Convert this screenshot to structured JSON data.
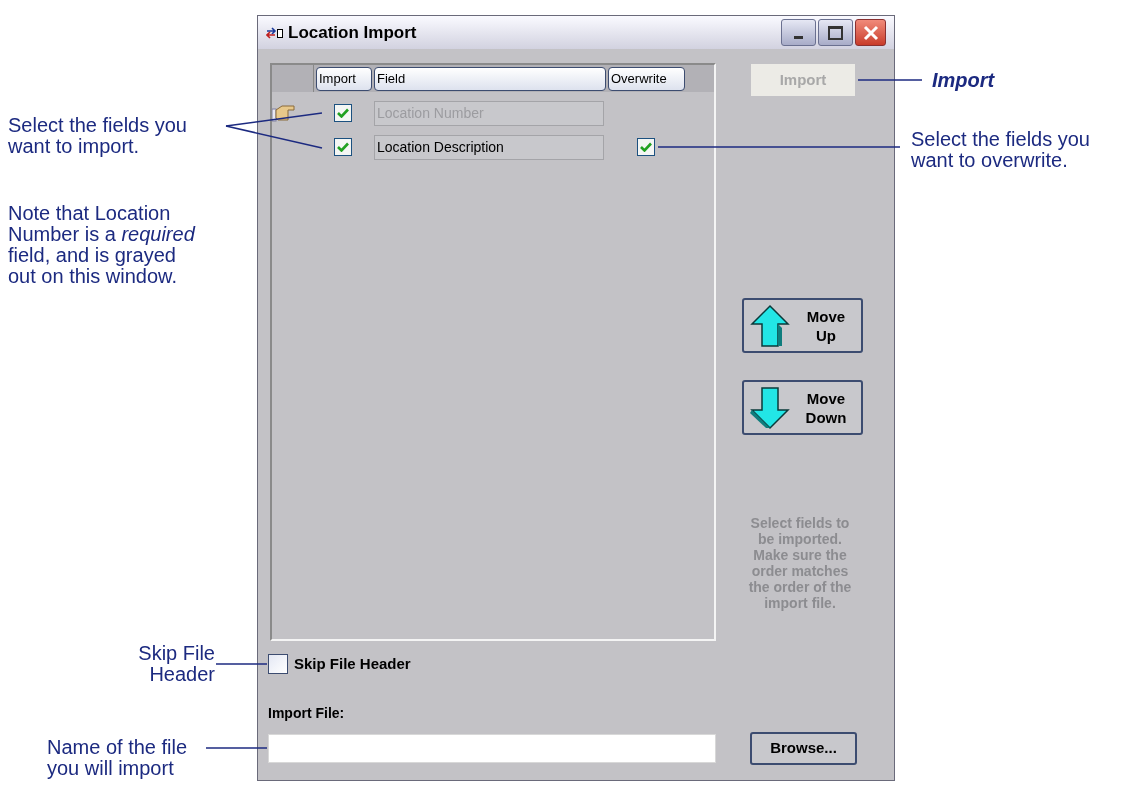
{
  "window": {
    "title": "Location Import"
  },
  "grid": {
    "columns": [
      "Import",
      "Field",
      "Overwrite"
    ],
    "rows": [
      {
        "current": true,
        "import": true,
        "field": "Location Number",
        "disabled": true
      },
      {
        "current": false,
        "import": true,
        "field": "Location Description",
        "disabled": false,
        "overwrite": true
      }
    ]
  },
  "import_button": {
    "label": "Import",
    "disabled": true
  },
  "move_buttons": [
    {
      "kind": "up",
      "label": "Move Up"
    },
    {
      "kind": "down",
      "label": "Move Down"
    }
  ],
  "hint": "Select fields to be imported. Make sure the order matches the order of the import file.",
  "skip_header": {
    "label": "Skip File Header",
    "checked": false
  },
  "import_file": {
    "label": "Import File:"
  },
  "browse_button": "Browse...",
  "callouts": {
    "import_fields": "Select the fields you want to import.",
    "note": "Note that Location Number is a *required* field, and is grayed out on this window.",
    "skip_header": "Skip File Header",
    "file_name": "Name of the file you will import",
    "import_button": "Import",
    "overwrite": "Select the fields you want to overwrite."
  }
}
